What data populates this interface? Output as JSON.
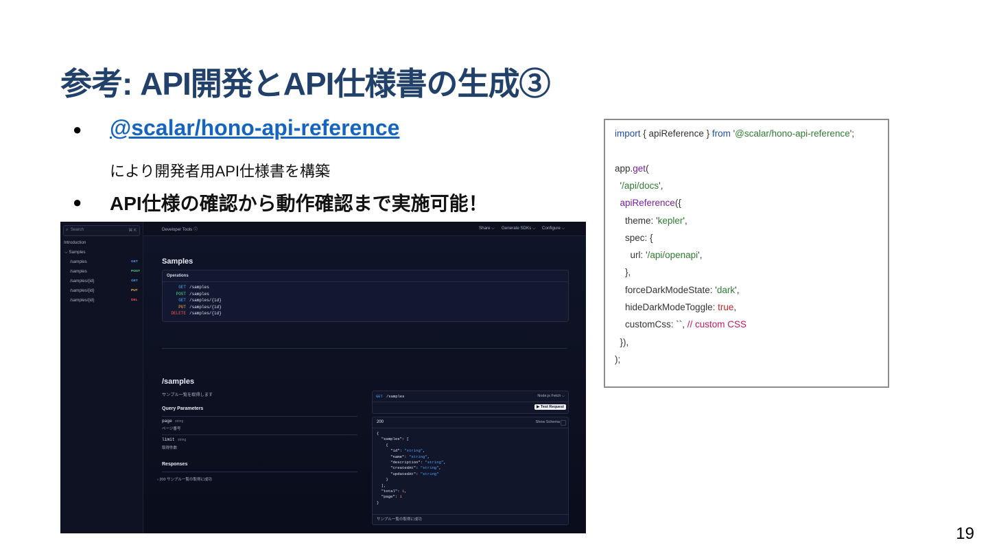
{
  "slide": {
    "title": "参考: API開発とAPI仕様書の生成③",
    "page_number": "19",
    "bullets": {
      "dot": "●",
      "link_text": "@scalar/hono-api-reference",
      "link_sub": "により開発者用API仕様書を構築",
      "second": "API仕様の確認から動作確認まで実施可能！"
    }
  },
  "code": {
    "lines": [
      [
        "import",
        " { apiReference } ",
        "from",
        " '",
        "@scalar/hono-api-reference",
        "';"
      ],
      [],
      [
        "app.",
        "get",
        "("
      ],
      [
        "  '",
        "/api/docs",
        "',"
      ],
      [
        "  ",
        "apiReference",
        "({"
      ],
      [
        "    theme: '",
        "kepler",
        "',"
      ],
      [
        "    spec: {"
      ],
      [
        "      url: '",
        "/api/openapi",
        "',"
      ],
      [
        "    },"
      ],
      [
        "    forceDarkModeState: '",
        "dark",
        "',"
      ],
      [
        "    hideDarkModeToggle: ",
        "true",
        ","
      ],
      [
        "    customCss: ``, ",
        "// custom CSS"
      ],
      [
        "  }),"
      ],
      [
        ");"
      ]
    ]
  },
  "app": {
    "search_placeholder": "Search",
    "search_shortcut": "⌘ K",
    "sidebar": {
      "introduction": "Introduction",
      "group": "Samples",
      "items": [
        {
          "path": "/samples",
          "method": "GET",
          "color": "#4da3ff"
        },
        {
          "path": "/samples",
          "method": "POST",
          "color": "#3ddc84"
        },
        {
          "path": "/samples/{id}",
          "method": "GET",
          "color": "#4da3ff"
        },
        {
          "path": "/samples/{id}",
          "method": "PUT",
          "color": "#ffb74d"
        },
        {
          "path": "/samples/{id}",
          "method": "DEL",
          "color": "#ff5252"
        }
      ]
    },
    "topbar": {
      "developer_tools": "Developer Tools ⓘ",
      "share": "Share ⌵",
      "generate": "Generate SDKs ⌵",
      "configure": "Configure ⌵"
    },
    "section_title": "Samples",
    "operations_label": "Operations",
    "operations": [
      {
        "method": "GET",
        "path": "/samples",
        "color": "#4da3ff"
      },
      {
        "method": "POST",
        "path": "/samples",
        "color": "#3ddc84"
      },
      {
        "method": "GET",
        "path": "/samples/{id}",
        "color": "#4da3ff"
      },
      {
        "method": "PUT",
        "path": "/samples/{id}",
        "color": "#ffb74d"
      },
      {
        "method": "DELETE",
        "path": "/samples/{id}",
        "color": "#ff5252"
      }
    ],
    "endpoint": {
      "title": "/samples",
      "description": "サンプル一覧を取得します",
      "query_params_label": "Query Parameters",
      "params": [
        {
          "name": "page",
          "type": "string",
          "desc": "ページ番号"
        },
        {
          "name": "limit",
          "type": "string",
          "desc": "取得件数"
        }
      ],
      "responses_label": "Responses",
      "response_row": "› 200 サンプル一覧の取得に成功",
      "request_method": "GET",
      "request_path": "/samples",
      "client": "Node.js Fetch ⌵",
      "test_request": "▶ Test Request",
      "status_tab": "200",
      "show_schema": "Show Schema",
      "response_footer": "サンプル一覧の取得に成功",
      "json_body": "{\n  \"samples\": [\n    {\n      \"id\": \"string\",\n      \"name\": \"string\",\n      \"description\": \"string\",\n      \"createdAt\": \"string\",\n      \"updatedAt\": \"string\"\n    }\n  ],\n  \"total\": 1,\n  \"page\": 1\n}"
    }
  }
}
